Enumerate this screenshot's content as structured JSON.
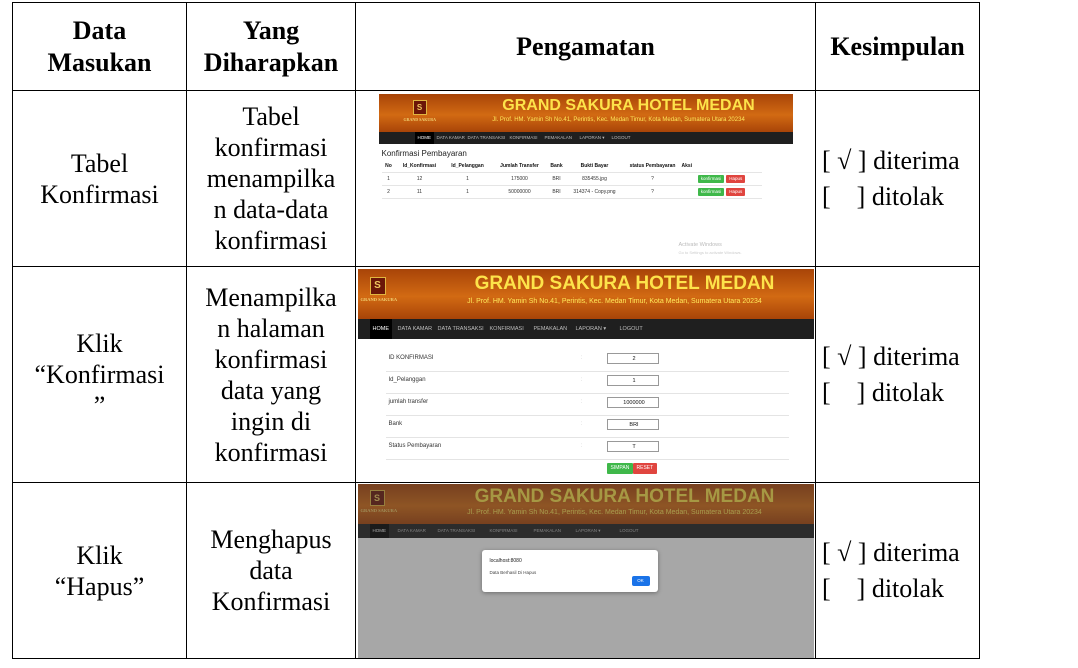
{
  "headers": [
    "Data Masukan",
    "Yang Diharapkan",
    "Pengamatan",
    "Kesimpulan"
  ],
  "header_lines": {
    "input": [
      "Data",
      "Masukan"
    ],
    "expected": [
      "Yang",
      "Diharapkan"
    ],
    "observation": "Pengamatan",
    "conclusion": "Kesimpulan"
  },
  "rows": [
    {
      "input_lines": [
        "Tabel",
        "Konfirmasi"
      ],
      "expected_lines": [
        "Tabel",
        "konfirmasi",
        "menampilka",
        "n data-data",
        "konfirmasi"
      ],
      "accepted": "[ √ ] diterima",
      "rejected": "[    ] ditolak"
    },
    {
      "input_lines": [
        "Klik",
        "“Konfirmasi",
        "”"
      ],
      "expected_lines": [
        "Menampilka",
        "n halaman",
        "konfirmasi",
        "data yang",
        "ingin di",
        "konfirmasi"
      ],
      "accepted": "[ √ ] diterima",
      "rejected": "[    ] ditolak"
    },
    {
      "input_lines": [
        "Klik",
        "“Hapus”"
      ],
      "expected_lines": [
        "Menghapus",
        "data",
        "Konfirmasi"
      ],
      "accepted": "[ √ ] diterima",
      "rejected": "[    ] ditolak"
    }
  ],
  "site": {
    "title": "GRAND SAKURA HOTEL MEDAN",
    "address": "Jl. Prof. HM. Yamin Sh No.41, Perintis, Kec. Medan Timur, Kota Medan, Sumatera Utara 20234",
    "logo_text": "GRAND SAKURA",
    "nav": [
      "HOME",
      "DATA KAMAR",
      "DATA TRANSAKSI",
      "KONFIRMASI",
      "PEMAKALAN",
      "LAPORAN ▾",
      "LOGOUT"
    ]
  },
  "shot1": {
    "page_title": "Konfirmasi Pembayaran",
    "columns": [
      "No",
      "Id_Konfirmasi",
      "Id_Pelanggan",
      "Jumlah Transfer",
      "Bank",
      "Bukti Bayar",
      "status Pembayaran",
      "Aksi"
    ],
    "rows": [
      [
        "1",
        "12",
        "1",
        "175000",
        "BRI",
        "835455.jpg",
        "?"
      ],
      [
        "2",
        "11",
        "1",
        "50000000",
        "BRI",
        "314374 - Copy.png",
        "?"
      ]
    ],
    "btn_confirm": "konfirmasi",
    "btn_delete": "Hapus",
    "watermark_title": "Activate Windows",
    "watermark_sub": "Go to Settings to activate Windows."
  },
  "shot2": {
    "fields": [
      {
        "label": "ID KONFIRMASI",
        "value": "2"
      },
      {
        "label": "Id_Pelanggan",
        "value": "1"
      },
      {
        "label": "jumlah transfer",
        "value": "1000000"
      },
      {
        "label": "Bank",
        "value": "BRI"
      },
      {
        "label": "Status Pembayaran",
        "value": "T"
      }
    ],
    "btn_save": "SIMPAN",
    "btn_reset": "RESET"
  },
  "shot3": {
    "dialog_title": "localhost:8080",
    "dialog_message": "Data Berhasil Di Hapus",
    "dialog_ok": "OK"
  }
}
